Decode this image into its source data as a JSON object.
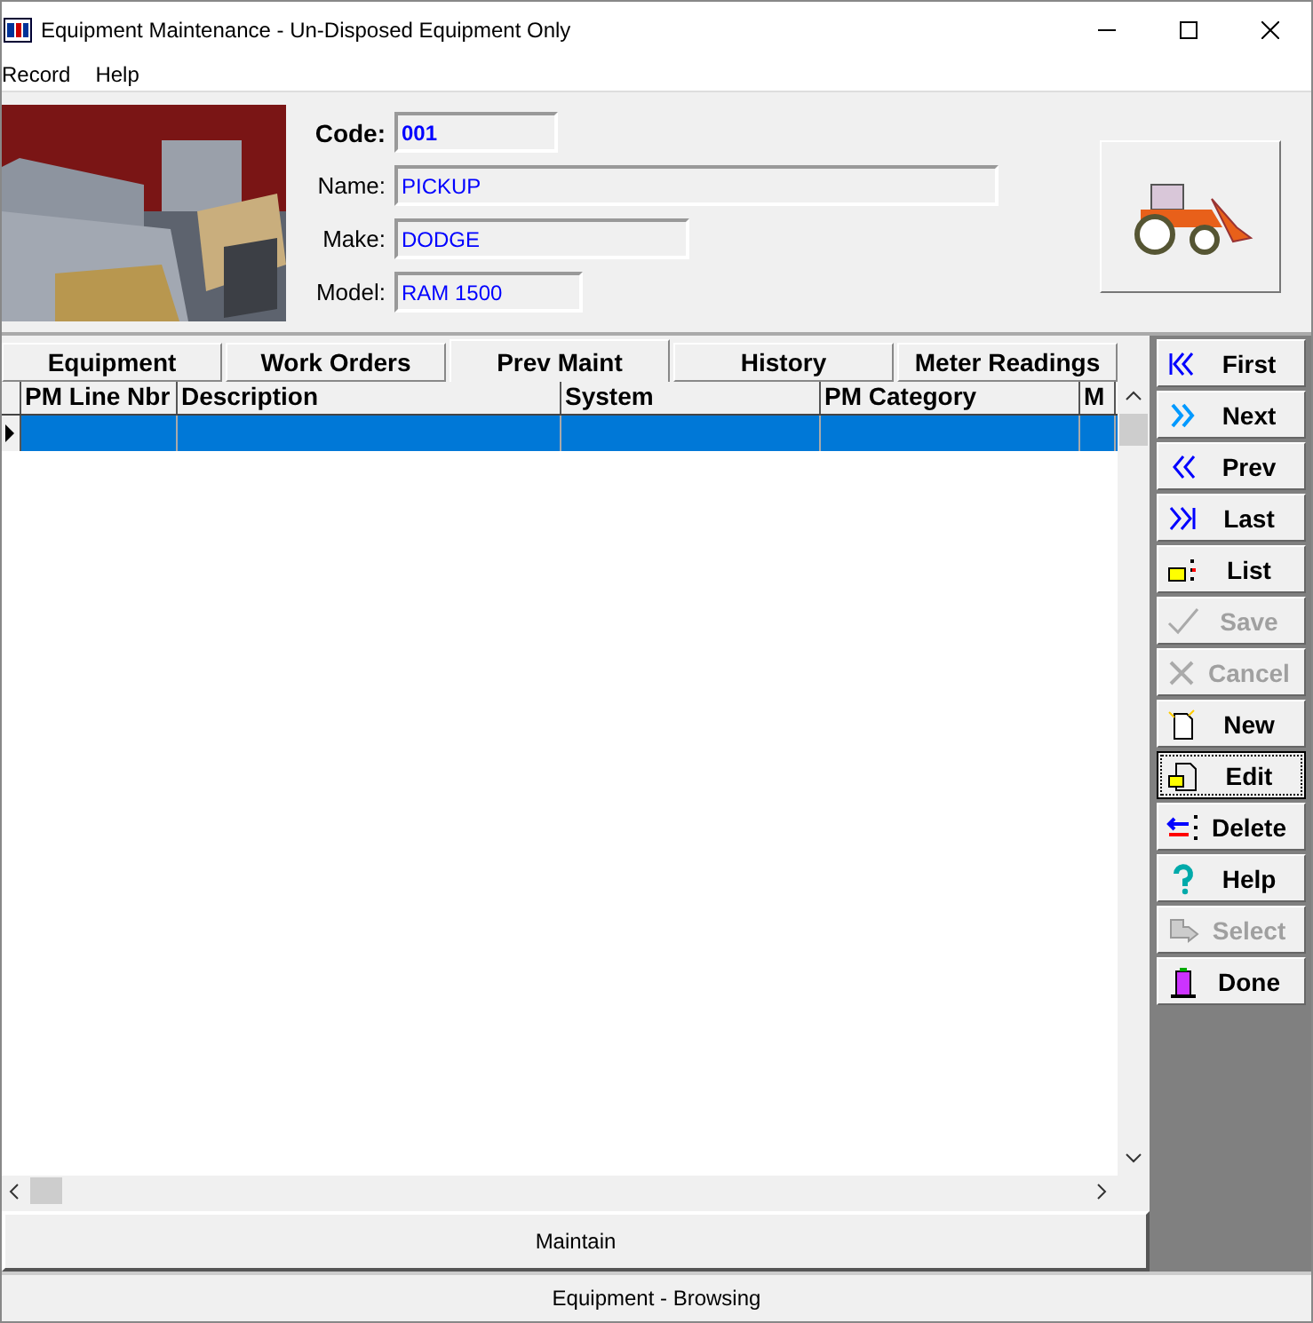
{
  "window": {
    "title": "Equipment Maintenance - Un-Disposed Equipment Only"
  },
  "menu": [
    "Record",
    "Help"
  ],
  "header": {
    "fields": [
      {
        "label": "Code:",
        "value": "001",
        "kind": "code"
      },
      {
        "label": "Name:",
        "value": "PICKUP",
        "kind": "wide"
      },
      {
        "label": "Make:",
        "value": "DODGE",
        "kind": "mid"
      },
      {
        "label": "Model:",
        "value": "RAM 1500",
        "kind": "short"
      }
    ]
  },
  "tabs": [
    {
      "label": "Equipment",
      "selected": false
    },
    {
      "label": "Work Orders",
      "selected": false
    },
    {
      "label": "Prev Maint",
      "selected": true
    },
    {
      "label": "History",
      "selected": false
    },
    {
      "label": "Meter Readings",
      "selected": false
    }
  ],
  "table": {
    "columns": [
      "PM Line Nbr",
      "Description",
      "System",
      "PM Category",
      "M"
    ],
    "rows": [
      {
        "selected": true
      }
    ]
  },
  "nav_buttons": [
    {
      "label": "First",
      "disabled": false,
      "focused": false
    },
    {
      "label": "Next",
      "disabled": false,
      "focused": false
    },
    {
      "label": "Prev",
      "disabled": false,
      "focused": false
    },
    {
      "label": "Last",
      "disabled": false,
      "focused": false
    },
    {
      "label": "List",
      "disabled": false,
      "focused": false
    },
    {
      "label": "Save",
      "disabled": true,
      "focused": false
    },
    {
      "label": "Cancel",
      "disabled": true,
      "focused": false
    },
    {
      "label": "New",
      "disabled": false,
      "focused": false
    },
    {
      "label": "Edit",
      "disabled": false,
      "focused": true
    },
    {
      "label": "Delete",
      "disabled": false,
      "focused": false
    },
    {
      "label": "Help",
      "disabled": false,
      "focused": false
    },
    {
      "label": "Select",
      "disabled": true,
      "focused": false
    },
    {
      "label": "Done",
      "disabled": false,
      "focused": false
    }
  ],
  "maintain_button": "Maintain",
  "status_bar": "Equipment - Browsing"
}
